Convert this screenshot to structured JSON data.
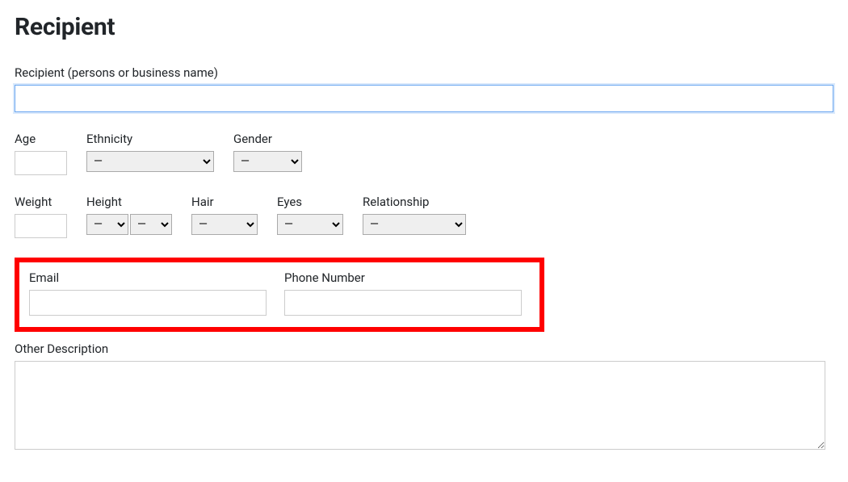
{
  "heading": "Recipient",
  "labels": {
    "recipient": "Recipient (persons or business name)",
    "age": "Age",
    "ethnicity": "Ethnicity",
    "gender": "Gender",
    "weight": "Weight",
    "height": "Height",
    "hair": "Hair",
    "eyes": "Eyes",
    "relationship": "Relationship",
    "email": "Email",
    "phone": "Phone Number",
    "other": "Other Description"
  },
  "values": {
    "recipient": "",
    "age": "",
    "ethnicity": "—",
    "gender": "—",
    "weight": "",
    "height_ft": "—",
    "height_in": "—",
    "hair": "—",
    "eyes": "—",
    "relationship": "—",
    "email": "",
    "phone": "",
    "other": ""
  }
}
